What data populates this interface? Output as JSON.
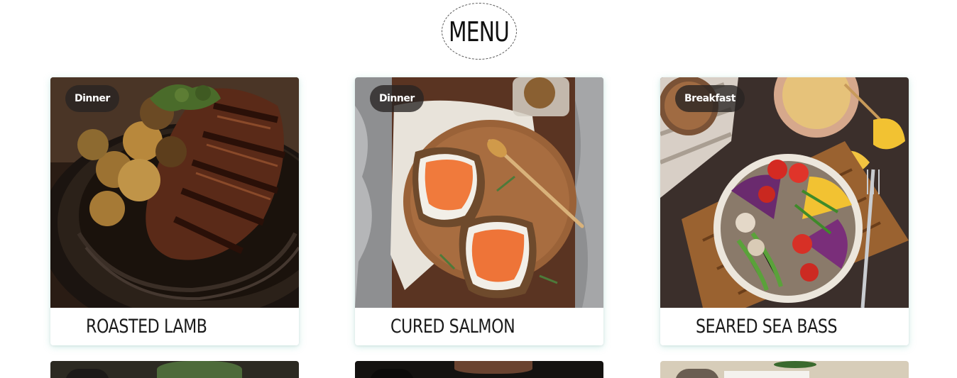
{
  "header": {
    "title": "MENU"
  },
  "cards": [
    {
      "category": "Dinner",
      "name": "ROASTED LAMB"
    },
    {
      "category": "Dinner",
      "name": "CURED SALMON"
    },
    {
      "category": "Breakfast",
      "name": "SEARED SEA BASS"
    }
  ],
  "colors": {
    "badge_bg": "#2a2624",
    "card_shadow": "#78c8b9",
    "title_text": "#111111"
  }
}
